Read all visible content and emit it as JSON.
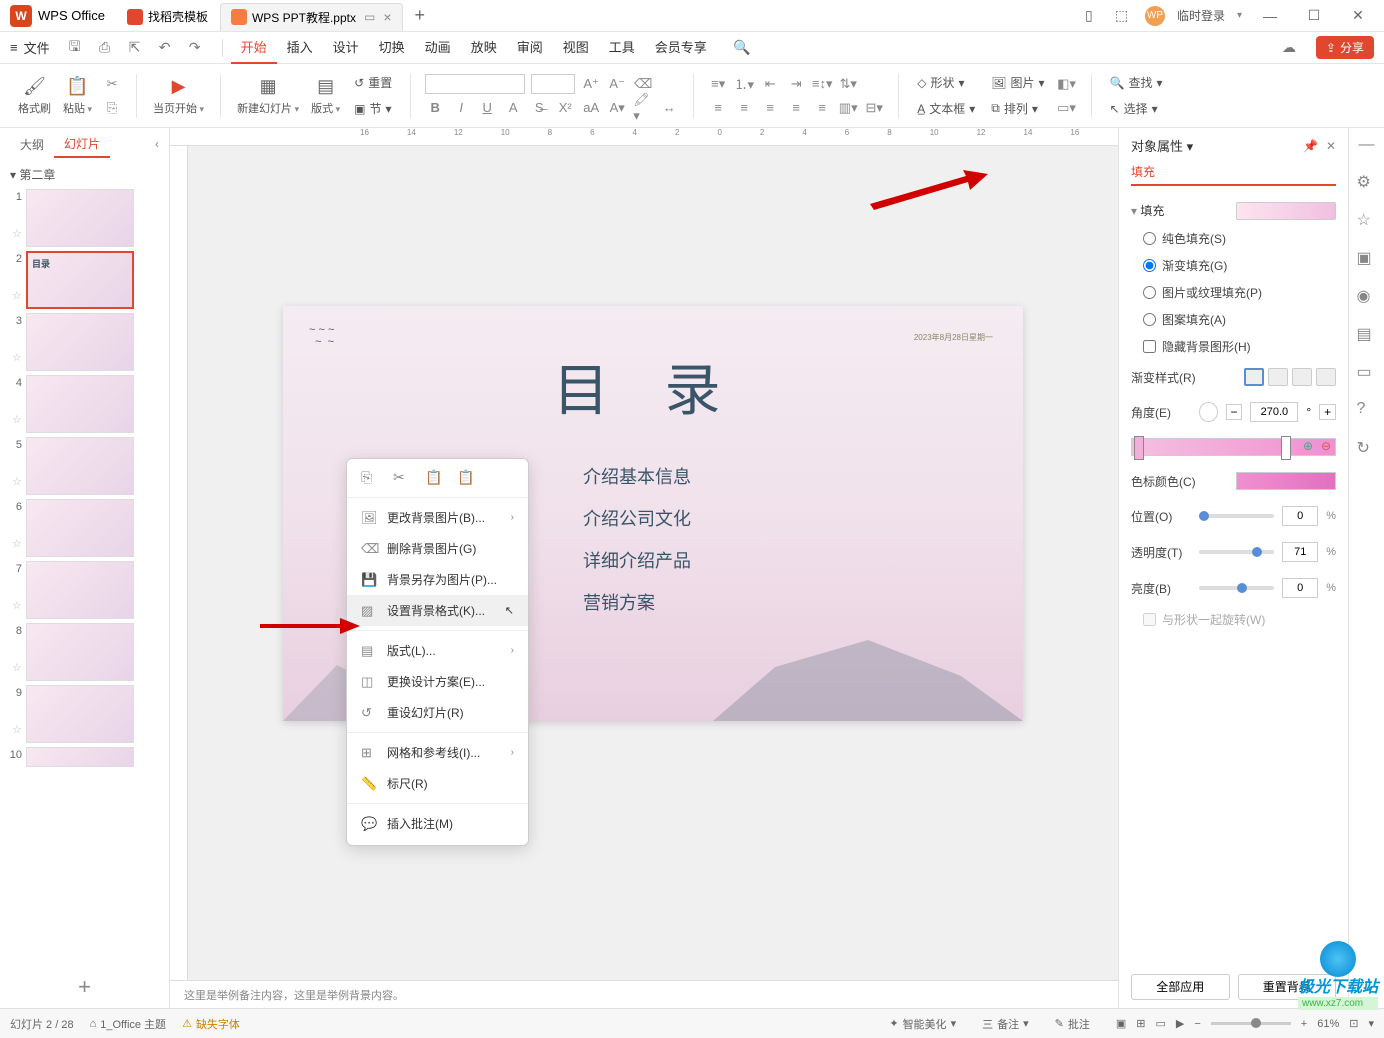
{
  "app": {
    "name": "WPS Office"
  },
  "tabs": [
    {
      "label": "找稻壳模板"
    },
    {
      "label": "WPS PPT教程.pptx",
      "active": true
    }
  ],
  "titlebar": {
    "login": "临时登录"
  },
  "menu": {
    "file": "文件",
    "tabs": [
      "开始",
      "插入",
      "设计",
      "切换",
      "动画",
      "放映",
      "审阅",
      "视图",
      "工具",
      "会员专享"
    ],
    "active": "开始",
    "share": "分享"
  },
  "ribbon": {
    "format_painter": "格式刷",
    "paste": "粘贴",
    "from_current": "当页开始",
    "new_slide": "新建幻灯片",
    "layout": "版式",
    "reset": "重置",
    "section": "节",
    "shape": "形状",
    "picture": "图片",
    "textbox": "文本框",
    "arrange": "排列",
    "find": "查找",
    "select": "选择"
  },
  "left_panel": {
    "outline_tab": "大纲",
    "slides_tab": "幻灯片",
    "chapter": "第二章",
    "add": "+"
  },
  "context_menu": {
    "change_bg": "更改背景图片(B)...",
    "delete_bg": "删除背景图片(G)",
    "save_bg_as": "背景另存为图片(P)...",
    "format_bg": "设置背景格式(K)...",
    "layout": "版式(L)...",
    "change_design": "更换设计方案(E)...",
    "reset_slide": "重设幻灯片(R)",
    "grid_guides": "网格和参考线(I)...",
    "ruler": "标尺(R)",
    "insert_comment": "插入批注(M)"
  },
  "slide": {
    "date": "2023年8月28日星期一",
    "title": "目 录",
    "items": [
      "介绍基本信息",
      "介绍公司文化",
      "详细介绍产品",
      "营销方案"
    ]
  },
  "notes": "这里是举例备注内容，这里是举例背景内容。",
  "right_panel": {
    "title": "对象属性",
    "tab_fill": "填充",
    "section_fill": "填充",
    "solid_fill": "纯色填充(S)",
    "gradient_fill": "渐变填充(G)",
    "picture_fill": "图片或纹理填充(P)",
    "pattern_fill": "图案填充(A)",
    "hide_bg": "隐藏背景图形(H)",
    "gradient_style": "渐变样式(R)",
    "angle": "角度(E)",
    "angle_val": "270.0",
    "angle_unit": "°",
    "stop_color": "色标颜色(C)",
    "position": "位置(O)",
    "position_val": "0",
    "transparency": "透明度(T)",
    "transparency_val": "71",
    "brightness": "亮度(B)",
    "brightness_val": "0",
    "rotate_with_shape": "与形状一起旋转(W)",
    "apply_all": "全部应用",
    "reset_bg": "重置背景",
    "pct": "%",
    "angle_plus": "+",
    "angle_minus": "−"
  },
  "statusbar": {
    "slide_info": "幻灯片 2 / 28",
    "theme": "1_Office 主题",
    "missing_font": "缺失字体",
    "ai_beautify": "智能美化",
    "notes_btn": "备注",
    "comments_btn": "批注",
    "zoom": "61%",
    "menu_3line": "三 "
  },
  "ruler_marks": [
    "16",
    "14",
    "12",
    "10",
    "8",
    "6",
    "4",
    "2",
    "0",
    "2",
    "4",
    "6",
    "8",
    "10",
    "12",
    "14",
    "16"
  ],
  "watermark": {
    "text": "极光下载站",
    "url": "www.xz7.com"
  }
}
